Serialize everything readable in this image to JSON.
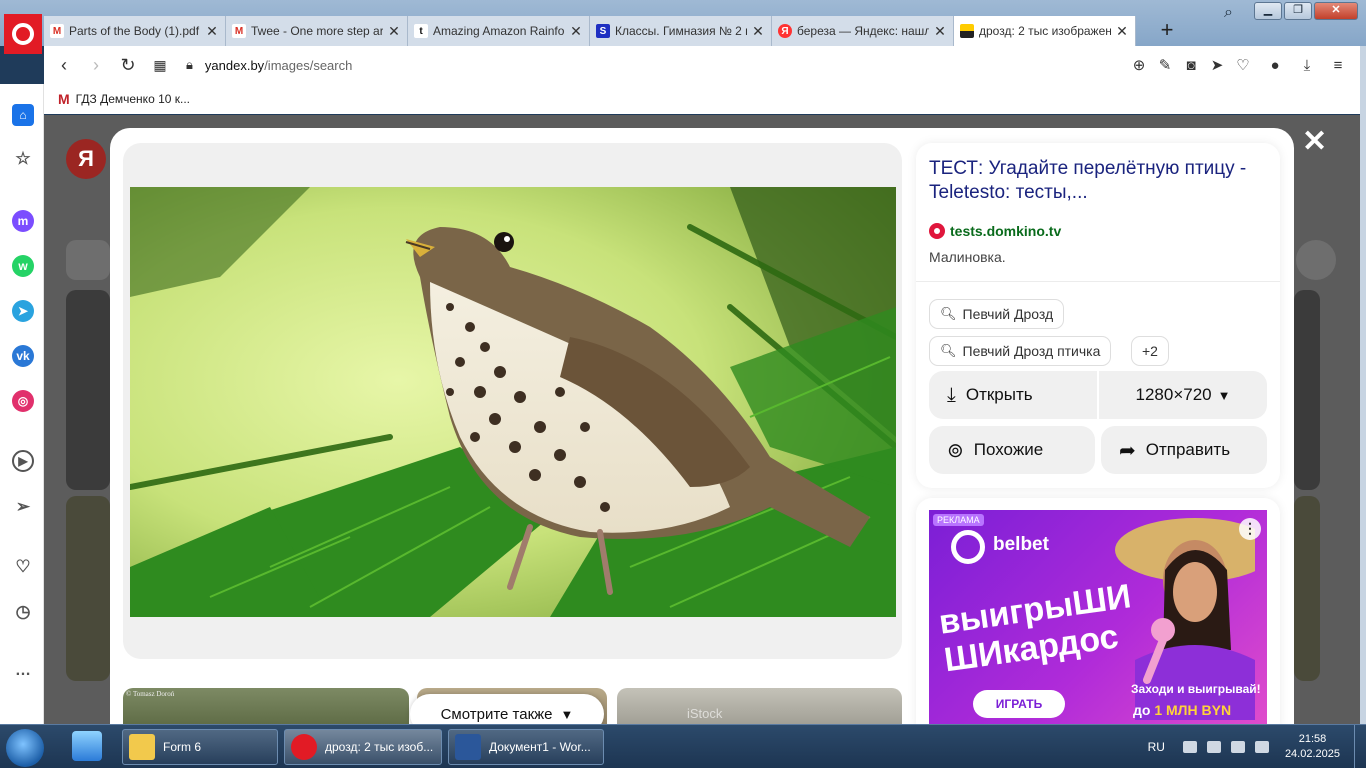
{
  "browser": {
    "tabs": [
      {
        "title": "Parts of the Body (1).pdf",
        "favicon": "gmail-icon",
        "active": false
      },
      {
        "title": "Twee - One more step ar",
        "favicon": "gmail-icon",
        "active": false
      },
      {
        "title": "Amazing Amazon Rainfo",
        "favicon": "tumblr-icon",
        "active": false
      },
      {
        "title": "Классы. Гимназия № 2 г",
        "favicon": "s-icon",
        "active": false
      },
      {
        "title": "береза — Яндекс: нашл",
        "favicon": "yandex-icon",
        "active": false
      },
      {
        "title": "дрозд: 2 тыс изображен",
        "favicon": "yandex-images-icon",
        "active": true
      }
    ],
    "url_host": "yandex.by",
    "url_path": "/images/search",
    "bookmark": "ГДЗ Демченко 10 к...",
    "new_tab": "+"
  },
  "viewer": {
    "title": "ТЕСТ: Угадайте перелётную птицу - Teletesto: тесты,...",
    "source": "tests.domkino.tv",
    "description": "Малиновка.",
    "chips": [
      "Певчий Дрозд",
      "Певчий Дрозд птичка"
    ],
    "chips_more": "+2",
    "open_label": "Открыть",
    "size_label": "1280×720",
    "similar_label": "Похожие",
    "share_label": "Отправить",
    "see_also": "Смотрите также",
    "close": "✕",
    "thumb_caption": "© Tomasz Doroń",
    "istock": "iStock"
  },
  "ad": {
    "tag": "РЕКЛАМА",
    "brand": "belbet",
    "headline": "выигрыШИ ШИкардос",
    "button": "ИГРАТЬ",
    "copy1": "Заходи и выигрывай!",
    "copy2_prefix": "до ",
    "copy2_highlight": "1 МЛН BYN",
    "menu": "⋮"
  },
  "taskbar": {
    "apps": [
      {
        "label": "Form 6"
      },
      {
        "label": "дрозд: 2 тыс изоб..."
      },
      {
        "label": "Документ1 - Wor..."
      }
    ],
    "lang": "RU",
    "time": "21:58",
    "date": "24.02.2025"
  },
  "colors": {
    "opera_red": "#e21b25",
    "title_link": "#1a237e",
    "source_green": "#0a6b1c"
  }
}
